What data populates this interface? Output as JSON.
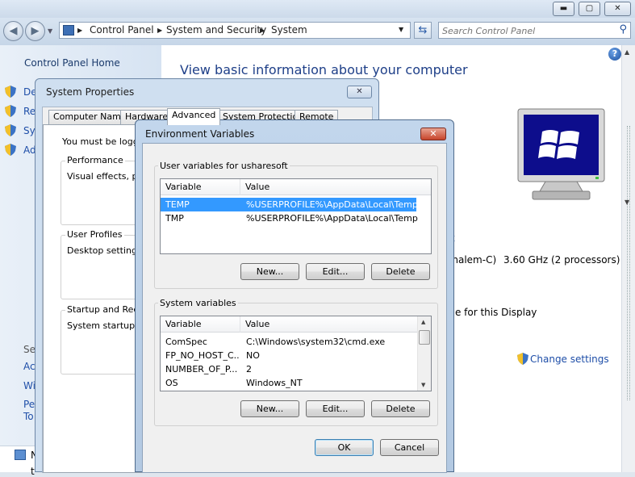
{
  "control_panel": {
    "breadcrumb": [
      "Control Panel",
      "System and Security",
      "System"
    ],
    "search_placeholder": "Search Control Panel",
    "left_panel": {
      "home_link": "Control Panel Home",
      "task_links_partial": [
        "De",
        "Re",
        "Sys",
        "Ad"
      ],
      "see_also_partial": "See",
      "bottom_links_partial": [
        "Act",
        "Wi",
        "Per",
        "To"
      ]
    },
    "main": {
      "heading": "View basic information about your computer",
      "processor_partial": "ehalem-C)",
      "processor_speed": "3.60 GHz  (2 processors)",
      "display_partial": "ble for this Display",
      "x_partial": "x",
      "change_settings": "Change settings"
    },
    "taskbar_partial": [
      "N",
      "t"
    ]
  },
  "system_properties": {
    "title": "System Properties",
    "tabs": [
      "Computer Name",
      "Hardware",
      "Advanced",
      "System Protection",
      "Remote"
    ],
    "active_tab": "Advanced",
    "notice_partial": "You must be logged",
    "groups": [
      {
        "label": "Performance",
        "text": "Visual effects, pro"
      },
      {
        "label": "User Profiles",
        "text": "Desktop settings r"
      },
      {
        "label": "Startup and Recov",
        "text": "System startup, sy"
      }
    ]
  },
  "environment_variables": {
    "title": "Environment Variables",
    "user_group_label": "User variables for usharesoft",
    "columns": [
      "Variable",
      "Value"
    ],
    "user_rows": [
      {
        "variable": "TEMP",
        "value": "%USERPROFILE%\\AppData\\Local\\Temp",
        "selected": true
      },
      {
        "variable": "TMP",
        "value": "%USERPROFILE%\\AppData\\Local\\Temp",
        "selected": false
      }
    ],
    "user_buttons": {
      "new": "New...",
      "edit": "Edit...",
      "delete": "Delete"
    },
    "system_group_label": "System variables",
    "system_rows": [
      {
        "variable": "ComSpec",
        "value": "C:\\Windows\\system32\\cmd.exe"
      },
      {
        "variable": "FP_NO_HOST_C...",
        "value": "NO"
      },
      {
        "variable": "NUMBER_OF_P...",
        "value": "2"
      },
      {
        "variable": "OS",
        "value": "Windows_NT"
      }
    ],
    "system_buttons": {
      "new": "New...",
      "edit": "Edit...",
      "delete": "Delete"
    },
    "ok": "OK",
    "cancel": "Cancel"
  },
  "icons": {
    "back": "back-arrow-icon",
    "forward": "forward-arrow-icon",
    "refresh": "refresh-icon",
    "search": "search-icon",
    "help": "help-icon",
    "shield": "uac-shield-icon",
    "close": "close-icon"
  },
  "colors": {
    "link": "#1e4ea8",
    "selection": "#3399ff",
    "window_frame": "#c2d6ec"
  }
}
